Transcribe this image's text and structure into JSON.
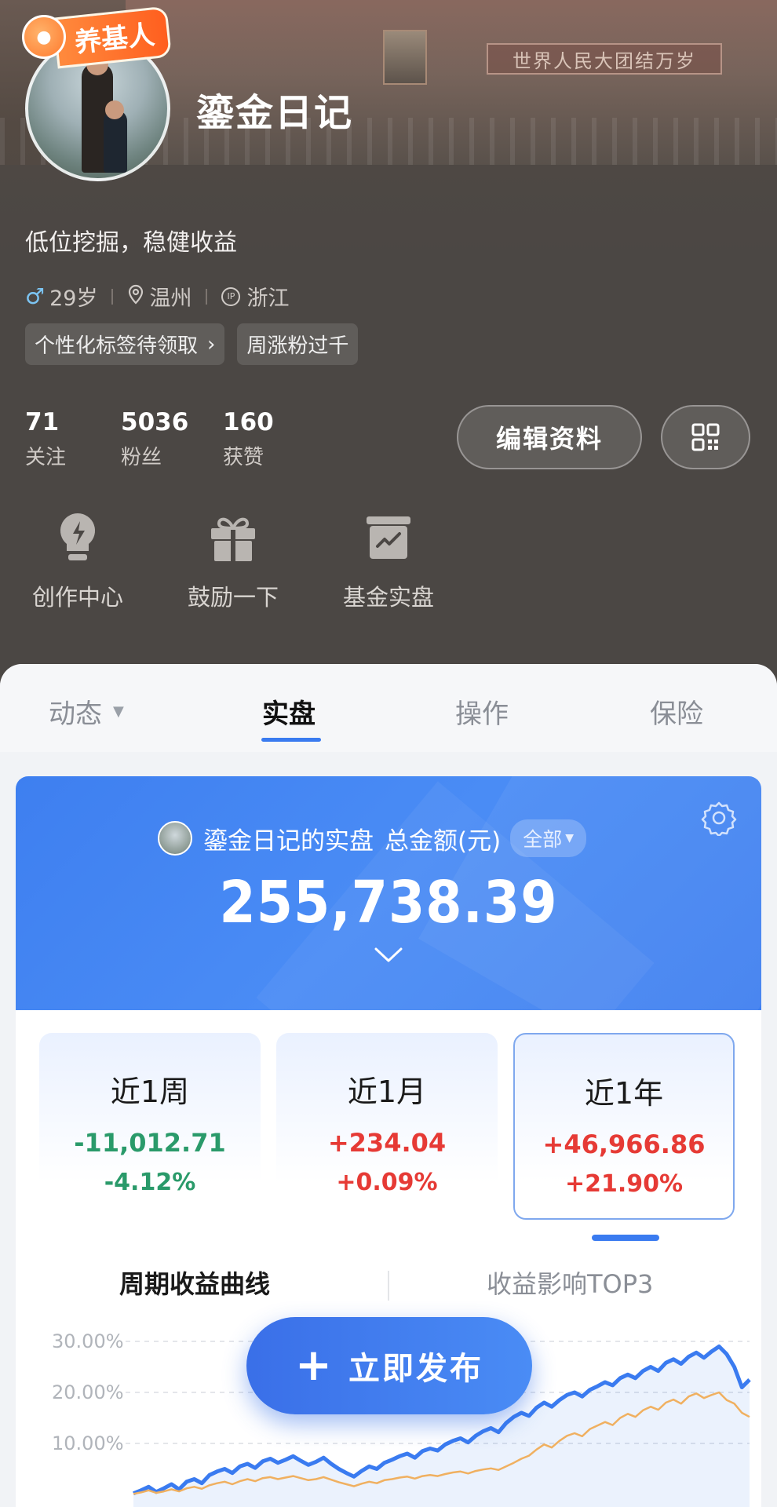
{
  "profile": {
    "badge_text": "养基人",
    "username": "鎏金日记",
    "bio": "低位挖掘，稳健收益",
    "gender_symbol": "♂",
    "age": "29岁",
    "city": "温州",
    "ip_region": "浙江",
    "ip_icon_text": "IP",
    "tags": [
      "个性化标签待领取",
      "周涨粉过千"
    ],
    "background_banner": "世界人民大团结万岁"
  },
  "stats": [
    {
      "num": "71",
      "label": "关注"
    },
    {
      "num": "5036",
      "label": "粉丝"
    },
    {
      "num": "160",
      "label": "获赞"
    }
  ],
  "buttons": {
    "edit_profile": "编辑资料",
    "publish": "立即发布"
  },
  "shortcuts": [
    {
      "label": "创作中心",
      "icon": "lightbulb-icon"
    },
    {
      "label": "鼓励一下",
      "icon": "gift-icon"
    },
    {
      "label": "基金实盘",
      "icon": "chart-box-icon"
    }
  ],
  "tabs": [
    {
      "label": "动态",
      "active": false
    },
    {
      "label": "实盘",
      "active": true
    },
    {
      "label": "操作",
      "active": false
    },
    {
      "label": "保险",
      "active": false
    }
  ],
  "portfolio": {
    "owner_label": "鎏金日记的实盘",
    "total_label": "总金额(元)",
    "filter": "全部",
    "total_amount": "255,738.39"
  },
  "periods": [
    {
      "name": "近1周",
      "amount": "-11,012.71",
      "percent": "-4.12%",
      "trend": "neg",
      "active": false
    },
    {
      "name": "近1月",
      "amount": "+234.04",
      "percent": "+0.09%",
      "trend": "pos",
      "active": false
    },
    {
      "name": "近1年",
      "amount": "+46,966.86",
      "percent": "+21.90%",
      "trend": "pos",
      "active": true
    }
  ],
  "subtabs": {
    "curve": "周期收益曲线",
    "top3": "收益影响TOP3"
  },
  "colors": {
    "accent": "#3a7bf0",
    "positive": "#e63a35",
    "negative": "#2a9a6a",
    "benchmark": "#f0b060"
  },
  "chart_data": {
    "type": "line",
    "title": "",
    "xlabel": "",
    "ylabel": "",
    "y_ticks": [
      "30.00%",
      "20.00%",
      "10.00%"
    ],
    "ylim": [
      -5,
      32
    ],
    "grid": true,
    "series": [
      {
        "values": [
          0.2,
          0.8,
          1.5,
          0.5,
          1.2,
          2.0,
          1.0,
          2.5,
          3.0,
          2.2,
          3.8,
          4.5,
          5.0,
          4.2,
          5.5,
          6.0,
          5.2,
          6.5,
          7.0,
          6.2,
          6.8,
          7.5,
          6.6,
          5.8,
          6.4,
          7.2,
          6.0,
          5.0,
          4.2,
          3.5,
          4.6,
          5.5,
          5.0,
          6.2,
          6.8,
          7.5,
          8.0,
          7.2,
          8.5,
          9.0,
          8.6,
          9.8,
          10.5,
          11.0,
          10.2,
          11.5,
          12.4,
          13.0,
          12.2,
          14.0,
          15.2,
          16.0,
          15.4,
          17.0,
          18.0,
          17.2,
          18.5,
          19.5,
          20.0,
          19.2,
          20.5,
          21.2,
          22.0,
          21.4,
          22.8,
          23.5,
          22.8,
          24.2,
          25.0,
          24.2,
          25.8,
          26.5,
          25.6,
          27.0,
          27.8,
          26.8,
          28.0,
          29.0,
          27.5,
          25.0,
          21.0,
          22.5
        ]
      },
      {
        "values": [
          0.1,
          0.4,
          0.8,
          0.3,
          0.6,
          1.0,
          0.6,
          1.2,
          1.5,
          1.1,
          1.8,
          2.2,
          2.5,
          2.0,
          2.6,
          3.0,
          2.6,
          3.2,
          3.4,
          3.0,
          3.3,
          3.6,
          3.2,
          2.8,
          3.0,
          3.4,
          2.9,
          2.4,
          2.0,
          1.6,
          2.1,
          2.5,
          2.2,
          2.8,
          3.0,
          3.3,
          3.5,
          3.1,
          3.6,
          3.8,
          3.6,
          4.0,
          4.3,
          4.5,
          4.1,
          4.6,
          4.9,
          5.1,
          4.8,
          5.5,
          6.2,
          7.0,
          7.6,
          8.8,
          9.8,
          9.2,
          10.5,
          11.5,
          12.0,
          11.4,
          12.8,
          13.5,
          14.2,
          13.6,
          15.0,
          15.8,
          15.2,
          16.5,
          17.2,
          16.6,
          18.0,
          18.6,
          17.8,
          19.2,
          19.8,
          18.9,
          19.5,
          20.0,
          18.5,
          17.8,
          16.0,
          15.2
        ]
      }
    ]
  }
}
